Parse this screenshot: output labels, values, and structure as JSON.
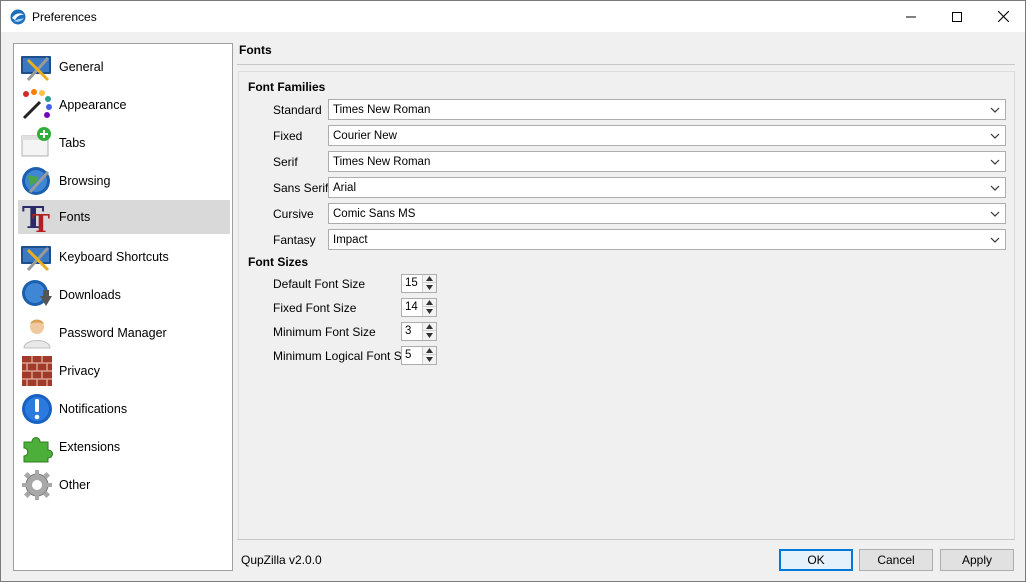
{
  "window": {
    "title": "Preferences"
  },
  "sidebar": {
    "items": [
      {
        "label": "General",
        "icon": "general-icon"
      },
      {
        "label": "Appearance",
        "icon": "appearance-icon"
      },
      {
        "label": "Tabs",
        "icon": "tabs-icon"
      },
      {
        "label": "Browsing",
        "icon": "browsing-icon"
      },
      {
        "label": "Fonts",
        "icon": "fonts-icon",
        "selected": true
      },
      {
        "label": "Keyboard Shortcuts",
        "icon": "keyboard-shortcuts-icon"
      },
      {
        "label": "Downloads",
        "icon": "downloads-icon"
      },
      {
        "label": "Password Manager",
        "icon": "password-manager-icon"
      },
      {
        "label": "Privacy",
        "icon": "privacy-icon"
      },
      {
        "label": "Notifications",
        "icon": "notifications-icon"
      },
      {
        "label": "Extensions",
        "icon": "extensions-icon"
      },
      {
        "label": "Other",
        "icon": "other-icon"
      }
    ]
  },
  "page": {
    "title": "Fonts",
    "font_families": {
      "title": "Font Families",
      "rows": [
        {
          "label": "Standard",
          "value": "Times New Roman"
        },
        {
          "label": "Fixed",
          "value": "Courier New"
        },
        {
          "label": "Serif",
          "value": "Times New Roman"
        },
        {
          "label": "Sans Serif",
          "value": "Arial"
        },
        {
          "label": "Cursive",
          "value": "Comic Sans MS"
        },
        {
          "label": "Fantasy",
          "value": "Impact"
        }
      ]
    },
    "font_sizes": {
      "title": "Font Sizes",
      "rows": [
        {
          "label": "Default Font Size",
          "value": "15"
        },
        {
          "label": "Fixed Font Size",
          "value": "14"
        },
        {
          "label": "Minimum Font Size",
          "value": "3"
        },
        {
          "label": "Minimum Logical Font Size",
          "value": "5"
        }
      ]
    }
  },
  "footer": {
    "version": "QupZilla v2.0.0",
    "ok_label": "OK",
    "cancel_label": "Cancel",
    "apply_label": "Apply"
  },
  "colors": {
    "accent": "#0078d7",
    "selected_bg": "#d9d9d9"
  }
}
